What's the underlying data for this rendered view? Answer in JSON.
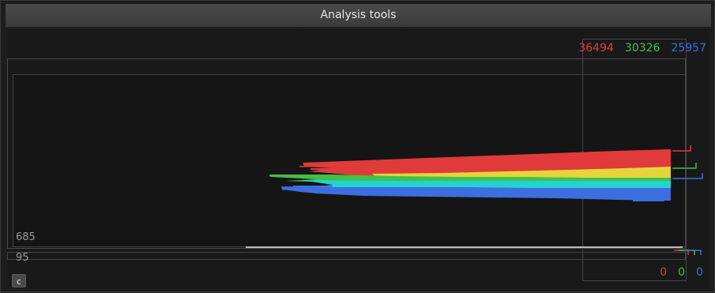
{
  "window": {
    "title": "Analysis tools"
  },
  "counts_top": {
    "red": "36494",
    "green": "30326",
    "blue": "25957"
  },
  "counts_bottom": {
    "red": "0",
    "green": "0",
    "blue": "0"
  },
  "axis": {
    "upper_label": "685",
    "lower_label": "95"
  },
  "controls": {
    "c_button_label": "c"
  },
  "colors": {
    "red": "#e03a3a",
    "yellow": "#e6d43c",
    "green": "#41c04a",
    "cyan": "#25d2d2",
    "blue": "#3c6ee0",
    "frame": "#555555",
    "background": "#191919"
  }
}
